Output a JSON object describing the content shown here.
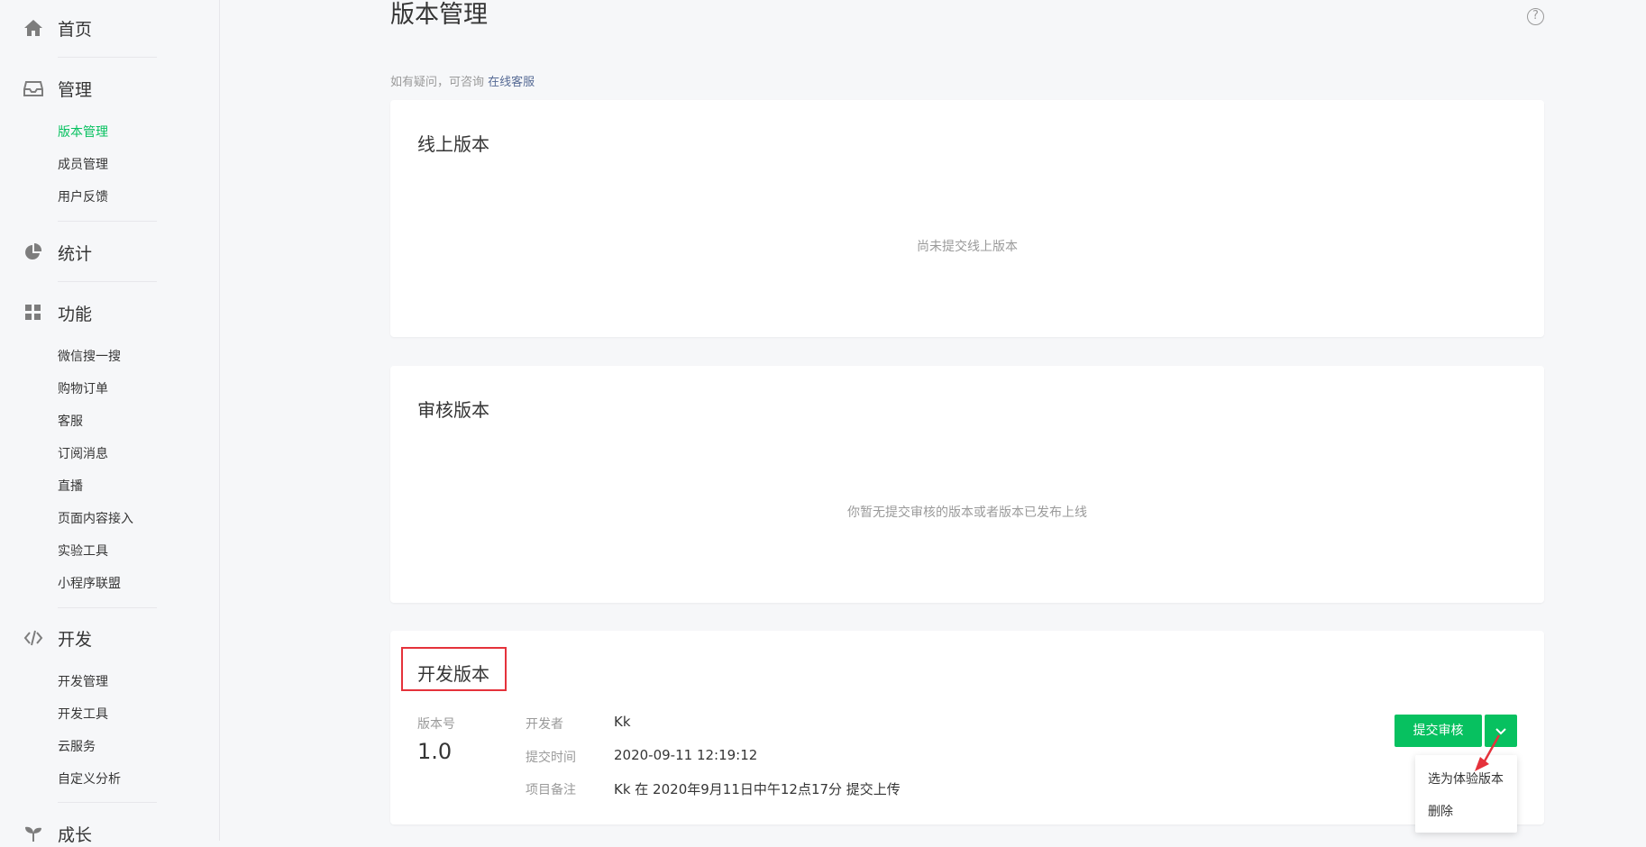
{
  "sidebar": {
    "home": "首页",
    "manage": "管理",
    "manage_items": [
      "版本管理",
      "成员管理",
      "用户反馈"
    ],
    "stats": "统计",
    "features": "功能",
    "feature_items": [
      "微信搜一搜",
      "购物订单",
      "客服",
      "订阅消息",
      "直播",
      "页面内容接入",
      "实验工具",
      "小程序联盟"
    ],
    "dev": "开发",
    "dev_items": [
      "开发管理",
      "开发工具",
      "云服务",
      "自定义分析"
    ],
    "growth": "成长"
  },
  "main": {
    "title": "版本管理",
    "help": "?",
    "hint_prefix": "如有疑问，可咨询",
    "hint_link": "在线客服",
    "online_card": {
      "title": "线上版本",
      "empty": "尚未提交线上版本"
    },
    "review_card": {
      "title": "审核版本",
      "empty": "你暂无提交审核的版本或者版本已发布上线"
    },
    "dev_card": {
      "title": "开发版本",
      "version_label": "版本号",
      "version_value": "1.0",
      "developer_label": "开发者",
      "developer_value": "Kk",
      "time_label": "提交时间",
      "time_value": "2020-09-11 12:19:12",
      "note_label": "项目备注",
      "note_value": "Kk 在 2020年9月11日中午12点17分 提交上传",
      "submit_button": "提交审核",
      "dropdown": [
        "选为体验版本",
        "删除"
      ]
    }
  },
  "colors": {
    "accent": "#07c160",
    "link": "#576b95",
    "highlight": "#e5323b"
  }
}
